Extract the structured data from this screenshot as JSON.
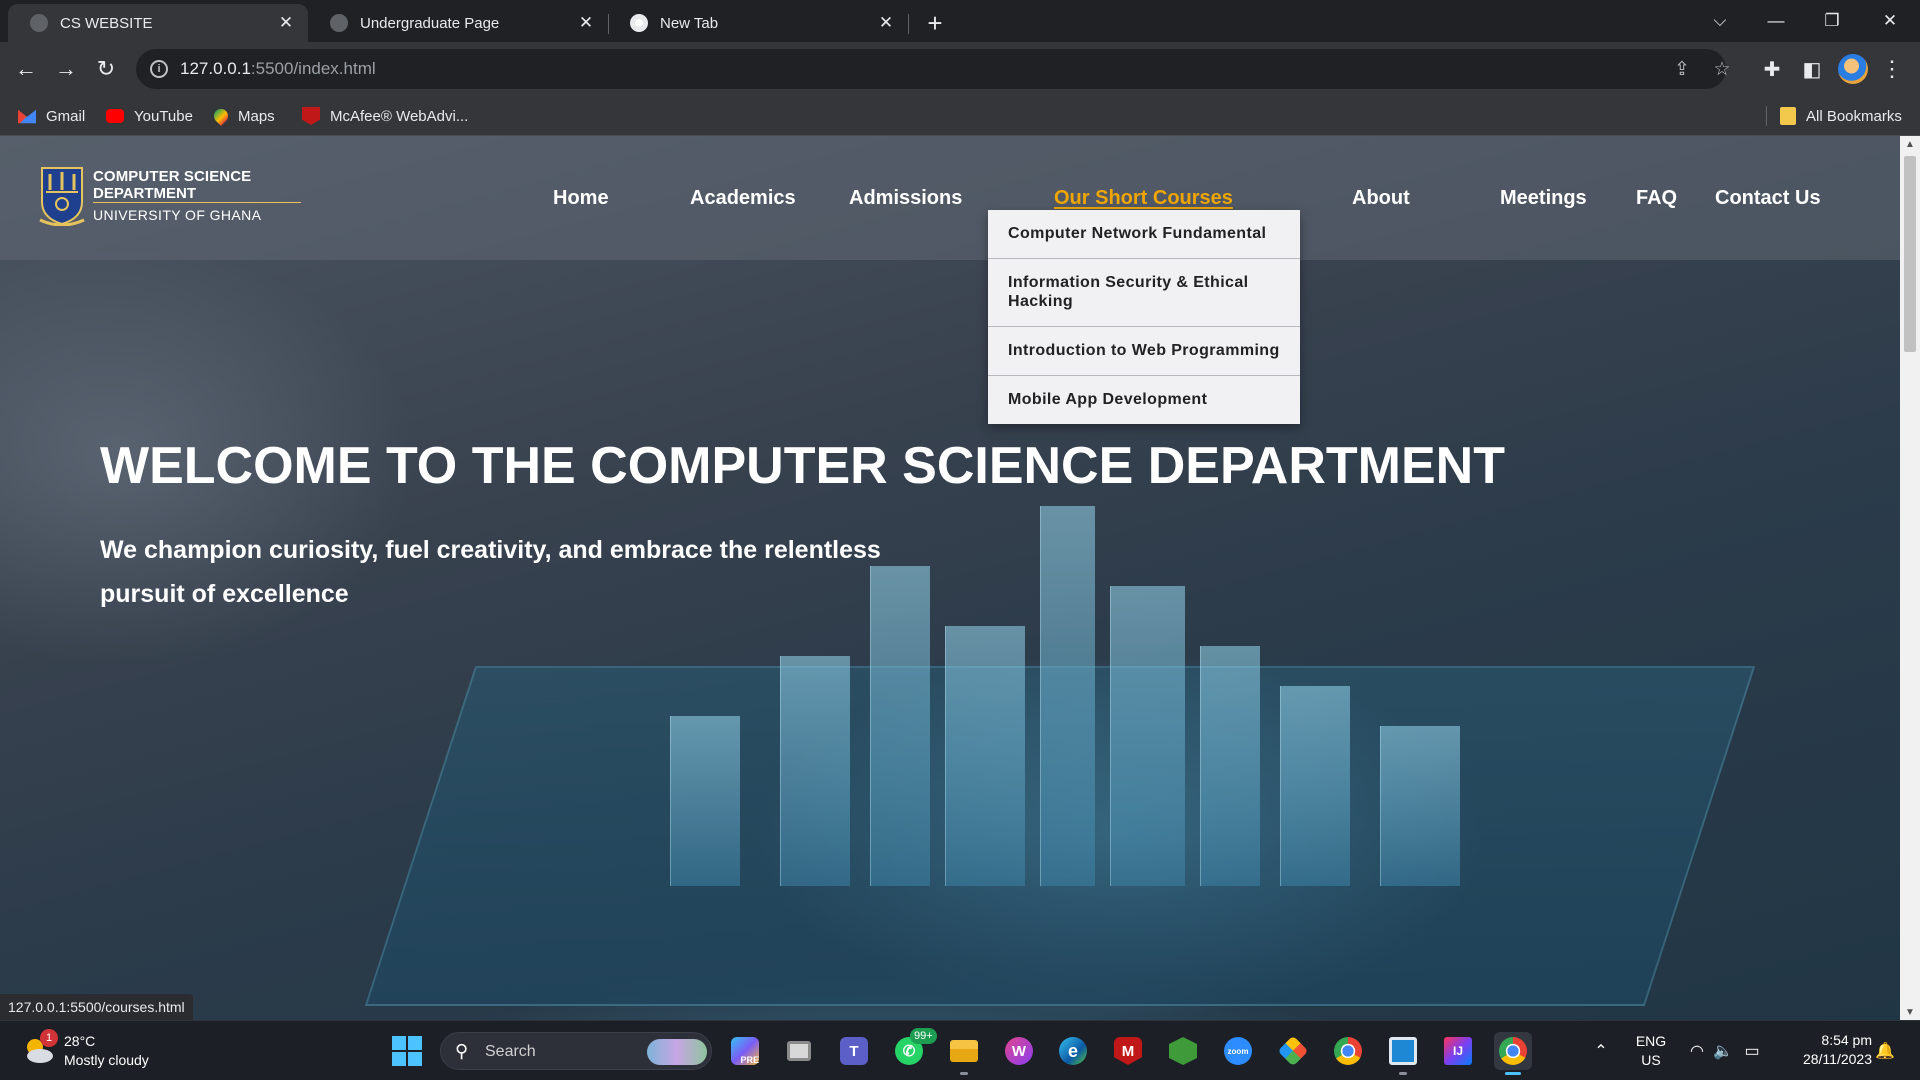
{
  "browser": {
    "tabs": [
      {
        "title": "CS WEBSITE",
        "active": true
      },
      {
        "title": "Undergraduate Page",
        "active": false
      },
      {
        "title": "New Tab",
        "active": false
      }
    ],
    "url": {
      "host": "127.0.0.1",
      "path": ":5500/index.html"
    },
    "bookmarks": [
      {
        "label": "Gmail",
        "icon": "gmail-icon"
      },
      {
        "label": "YouTube",
        "icon": "youtube-icon"
      },
      {
        "label": "Maps",
        "icon": "maps-icon"
      },
      {
        "label": "McAfee® WebAdvi...",
        "icon": "mcafee-icon"
      }
    ],
    "all_bookmarks_label": "All Bookmarks",
    "status_url": "127.0.0.1:5500/courses.html"
  },
  "site": {
    "logo": {
      "line1": "COMPUTER SCIENCE",
      "line2": "DEPARTMENT",
      "line3": "UNIVERSITY OF GHANA"
    },
    "nav": [
      {
        "label": "Home"
      },
      {
        "label": "Academics"
      },
      {
        "label": "Admissions"
      },
      {
        "label": "Our Short Courses",
        "active": true
      },
      {
        "label": "About"
      },
      {
        "label": "Meetings"
      },
      {
        "label": "FAQ"
      },
      {
        "label": "Contact Us"
      }
    ],
    "dropdown": [
      "Computer Network Fundamental",
      "Information Security & Ethical Hacking",
      "Introduction to Web Programming",
      "Mobile App Development"
    ],
    "hero": {
      "title": "WELCOME TO THE COMPUTER SCIENCE DEPARTMENT",
      "subtitle": "We champion curiosity, fuel creativity, and embrace the relentless pursuit of excellence"
    },
    "colors": {
      "nav_active": "#f0a500",
      "dropdown_bg": "#f1f1f3"
    }
  },
  "taskbar": {
    "weather": {
      "badge": "1",
      "temp": "28°C",
      "desc": "Mostly cloudy"
    },
    "search_label": "Search",
    "apps": [
      {
        "name": "copilot-app-icon",
        "label": "PRE"
      },
      {
        "name": "task-view-icon",
        "label": ""
      },
      {
        "name": "teams-icon",
        "label": "T"
      },
      {
        "name": "whatsapp-icon",
        "label": "W",
        "badge": "99+"
      },
      {
        "name": "file-explorer-icon",
        "label": ""
      },
      {
        "name": "wps-office-icon",
        "label": "W"
      },
      {
        "name": "edge-icon",
        "label": "e"
      },
      {
        "name": "mcafee-app-icon",
        "label": "M"
      },
      {
        "name": "node-icon",
        "label": ""
      },
      {
        "name": "zoom-icon",
        "label": "zoom"
      },
      {
        "name": "git-icon",
        "label": ""
      },
      {
        "name": "chrome-icon",
        "label": ""
      },
      {
        "name": "vscode-window-icon",
        "label": ""
      },
      {
        "name": "intellij-icon",
        "label": "IJ"
      },
      {
        "name": "chrome-active-icon",
        "label": ""
      }
    ],
    "lang": {
      "line1": "ENG",
      "line2": "US"
    },
    "time": "8:54 pm",
    "date": "28/11/2023"
  }
}
